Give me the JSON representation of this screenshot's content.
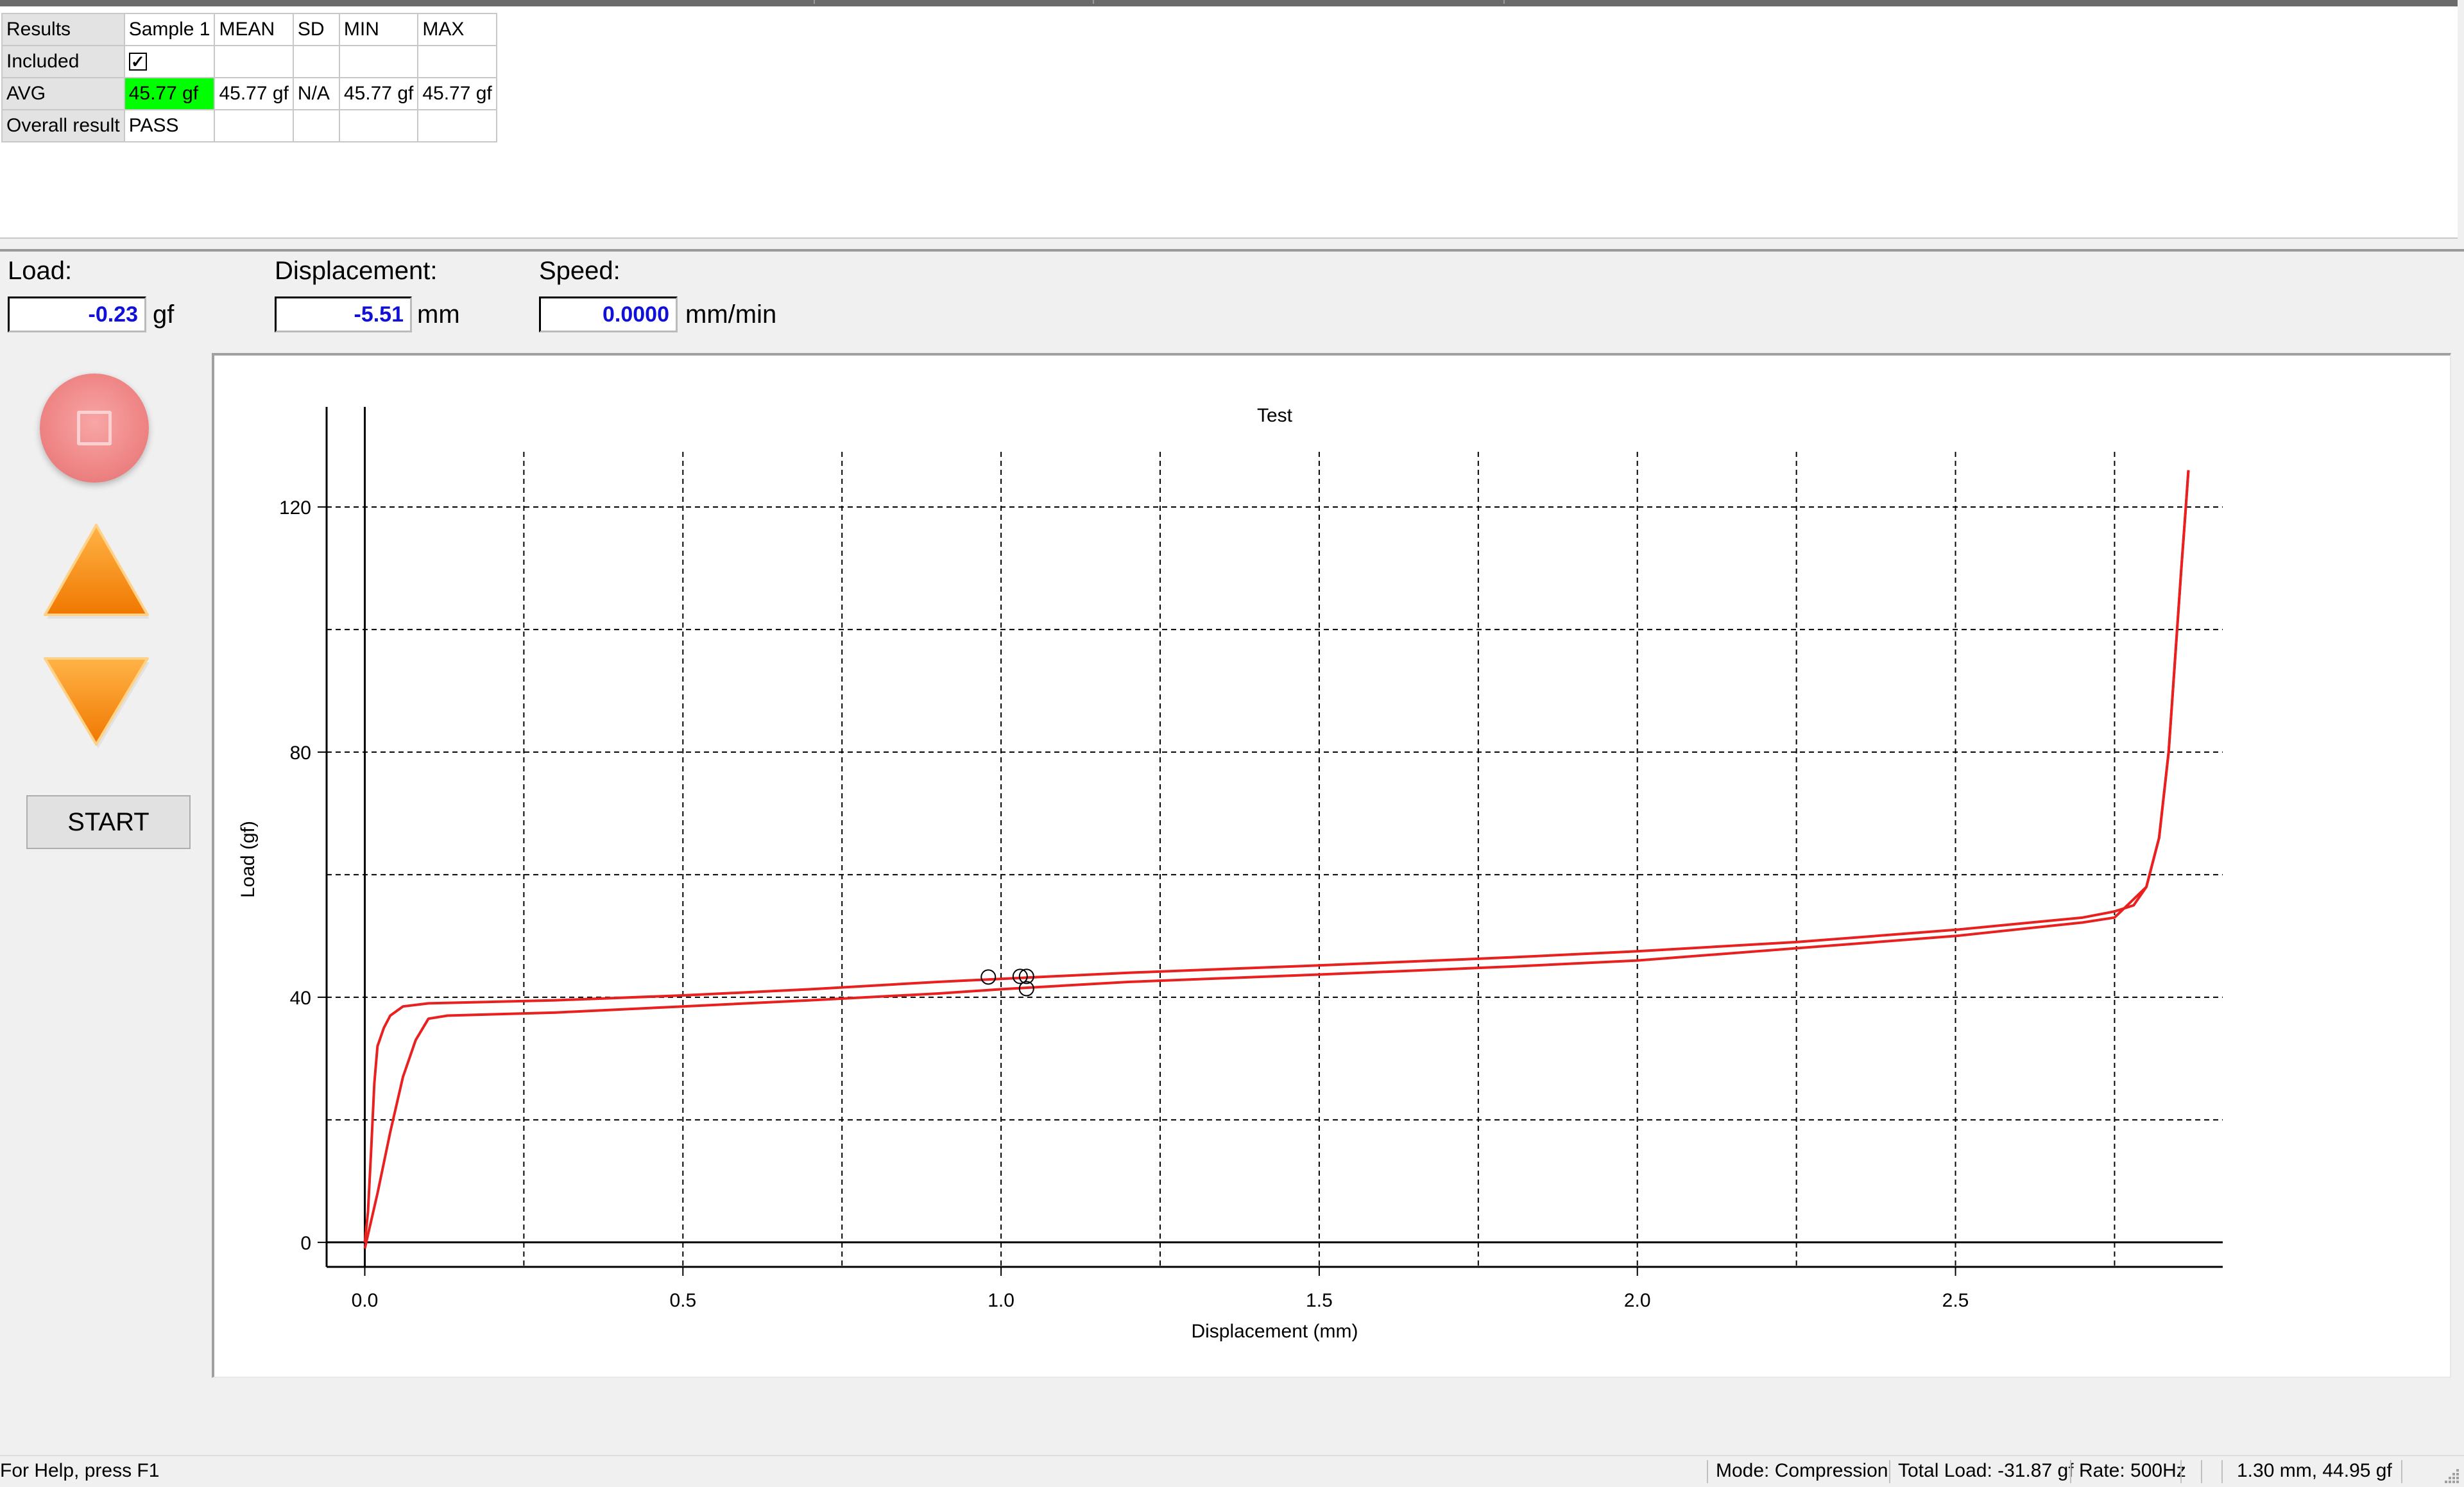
{
  "results_table": {
    "headers": [
      "Results",
      "Sample 1",
      "MEAN",
      "SD",
      "MIN",
      "MAX"
    ],
    "rows": [
      {
        "label": "Included",
        "cells": [
          "✓",
          "",
          "",
          "",
          ""
        ]
      },
      {
        "label": "AVG",
        "cells": [
          "45.77 gf",
          "45.77 gf",
          "N/A",
          "45.77 gf",
          "45.77 gf"
        ]
      },
      {
        "label": "Overall result",
        "cells": [
          "PASS",
          "",
          "",
          "",
          ""
        ]
      }
    ],
    "highlight_color": "#00ff00"
  },
  "readouts": {
    "load": {
      "label": "Load:",
      "value": "-0.23",
      "unit": "gf"
    },
    "displacement": {
      "label": "Displacement:",
      "value": "-5.51",
      "unit": "mm"
    },
    "speed": {
      "label": "Speed:",
      "value": "0.0000",
      "unit": "mm/min"
    }
  },
  "controls": {
    "stop_icon": "stop-square-icon",
    "up_icon": "arrow-up-icon",
    "down_icon": "arrow-down-icon",
    "start_label": "START"
  },
  "chart_data": {
    "type": "line",
    "title": "Test",
    "xlabel": "Displacement (mm)",
    "ylabel": "Load (gf)",
    "xlim": [
      -0.06,
      2.92
    ],
    "ylim": [
      -4,
      129
    ],
    "x_ticks": [
      0.0,
      0.5,
      1.0,
      1.5,
      2.0,
      2.5
    ],
    "x_tick_labels": [
      "0.0",
      "0.5",
      "1.0",
      "1.5",
      "2.0",
      "2.5"
    ],
    "y_ticks": [
      0,
      40,
      80,
      120
    ],
    "y_tick_labels": [
      "0",
      "40",
      "80",
      "120"
    ],
    "x_grid": [
      0.25,
      0.5,
      0.75,
      1.0,
      1.25,
      1.5,
      1.75,
      2.0,
      2.25,
      2.5,
      2.75
    ],
    "y_grid": [
      0,
      20,
      40,
      60,
      80,
      100,
      120
    ],
    "grid": true,
    "color": "#e8201f",
    "series": [
      {
        "points": [
          [
            0.0,
            0
          ],
          [
            0.005,
            5
          ],
          [
            0.01,
            15
          ],
          [
            0.015,
            26
          ],
          [
            0.02,
            32
          ],
          [
            0.03,
            35
          ],
          [
            0.04,
            37
          ],
          [
            0.06,
            38.5
          ],
          [
            0.1,
            39
          ],
          [
            0.3,
            39.5
          ],
          [
            0.5,
            40.3
          ],
          [
            0.7,
            41.3
          ],
          [
            0.9,
            42.5
          ],
          [
            1.0,
            43
          ],
          [
            1.2,
            44
          ],
          [
            1.5,
            45.2
          ],
          [
            1.8,
            46.5
          ],
          [
            2.0,
            47.5
          ],
          [
            2.25,
            49
          ],
          [
            2.5,
            51
          ],
          [
            2.7,
            53
          ],
          [
            2.75,
            54
          ],
          [
            2.78,
            55
          ],
          [
            2.8,
            58
          ],
          [
            2.82,
            66
          ],
          [
            2.835,
            80
          ],
          [
            2.845,
            95
          ],
          [
            2.855,
            110
          ],
          [
            2.862,
            120
          ],
          [
            2.866,
            126
          ]
        ]
      },
      {
        "points": [
          [
            0.0,
            -1
          ],
          [
            0.02,
            8
          ],
          [
            0.04,
            18
          ],
          [
            0.06,
            27
          ],
          [
            0.08,
            33
          ],
          [
            0.1,
            36.5
          ],
          [
            0.13,
            37
          ],
          [
            0.3,
            37.5
          ],
          [
            0.5,
            38.5
          ],
          [
            0.7,
            39.5
          ],
          [
            0.9,
            40.6
          ],
          [
            1.0,
            41.3
          ],
          [
            1.2,
            42.5
          ],
          [
            1.5,
            43.7
          ],
          [
            1.8,
            45
          ],
          [
            2.0,
            46
          ],
          [
            2.25,
            48
          ],
          [
            2.5,
            50
          ],
          [
            2.7,
            52.2
          ],
          [
            2.75,
            53
          ],
          [
            2.8,
            58
          ],
          [
            2.82,
            66
          ],
          [
            2.835,
            80
          ],
          [
            2.845,
            95
          ],
          [
            2.855,
            110
          ],
          [
            2.862,
            120
          ],
          [
            2.866,
            126
          ]
        ]
      }
    ],
    "markers": [
      {
        "x": 0.98,
        "y": 43.3
      },
      {
        "x": 1.03,
        "y": 43.4
      },
      {
        "x": 1.04,
        "y": 43.4
      },
      {
        "x": 1.04,
        "y": 41.4
      }
    ]
  },
  "status_bar": {
    "help": "For Help, press F1",
    "mode": "Mode: Compression",
    "total_load": "Total Load: -31.87 gf",
    "rate": "Rate: 500Hz",
    "position": "1.30 mm, 44.95 gf"
  }
}
